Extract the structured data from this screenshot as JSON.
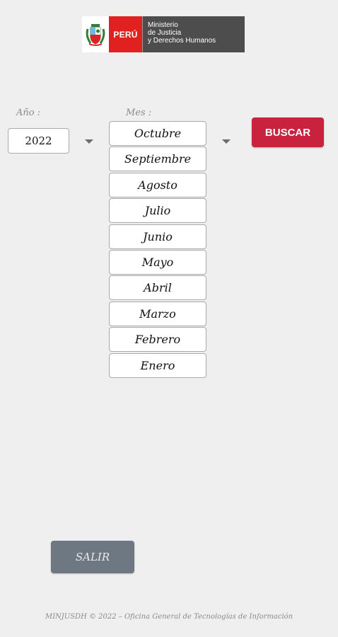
{
  "logo": {
    "country": "PERÚ",
    "ministry_line1": "Ministerio",
    "ministry_line2": "de Justicia",
    "ministry_line3": "y Derechos Humanos",
    "emblem_icon": "coat-of-arms-icon"
  },
  "form": {
    "year_label": "Año :",
    "month_label": "Mes :",
    "year_value": "2022",
    "months": [
      "Octubre",
      "Septiembre",
      "Agosto",
      "Julio",
      "Junio",
      "Mayo",
      "Abril",
      "Marzo",
      "Febrero",
      "Enero"
    ],
    "selected_month": "Octubre",
    "search_label": "BUSCAR"
  },
  "actions": {
    "exit_label": "SALIR"
  },
  "footer": {
    "text": "MINJUSDH © 2022 – Oficina General de Tecnologías de Información"
  },
  "colors": {
    "background": "#efefef",
    "search_button": "#c8223f",
    "exit_button": "#6e7882",
    "brand_red": "#e1211f",
    "brand_gray": "#4d4d4d"
  }
}
